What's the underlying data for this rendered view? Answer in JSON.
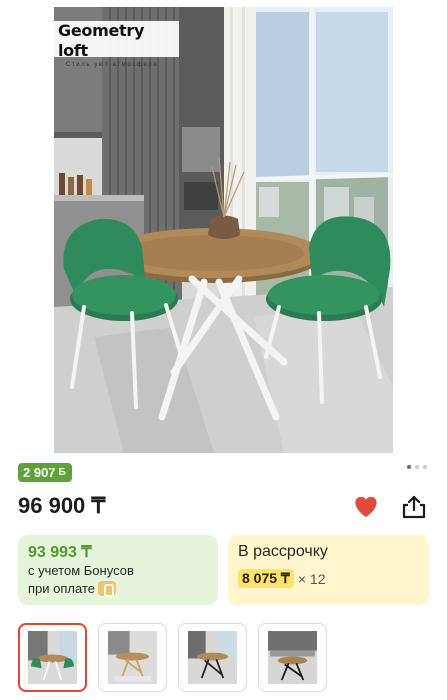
{
  "brand": {
    "name": "Geometry loft",
    "tagline": "Стиль уют атмосфера"
  },
  "bonus_badge": {
    "amount": "2 907",
    "icon": "bonus-currency-icon"
  },
  "gallery": {
    "total_dots": 3,
    "active_dot": 1
  },
  "price": {
    "main": "96 900 ₸"
  },
  "actions": {
    "favorite_icon": "heart-icon",
    "favorite_color": "#e04a3c",
    "share_icon": "share-icon"
  },
  "bonus_card": {
    "amount": "93 993 ₸",
    "line1": "с учетом Бонусов",
    "line2": "при оплате",
    "accent": "#4f9a2c",
    "background": "#e6f4dc"
  },
  "installment_card": {
    "title": "В рассрочку",
    "amount": "8 075 ₸",
    "multiplier": "× 12",
    "background": "#fff6cc"
  },
  "thumbnails": [
    {
      "name": "thumbnail-1",
      "selected": true,
      "variant": "green-chairs-white-legs"
    },
    {
      "name": "thumbnail-2",
      "selected": false,
      "variant": "gold-legs"
    },
    {
      "name": "thumbnail-3",
      "selected": false,
      "variant": "black-legs"
    },
    {
      "name": "thumbnail-4",
      "selected": false,
      "variant": "black-legs-kitchen"
    }
  ]
}
